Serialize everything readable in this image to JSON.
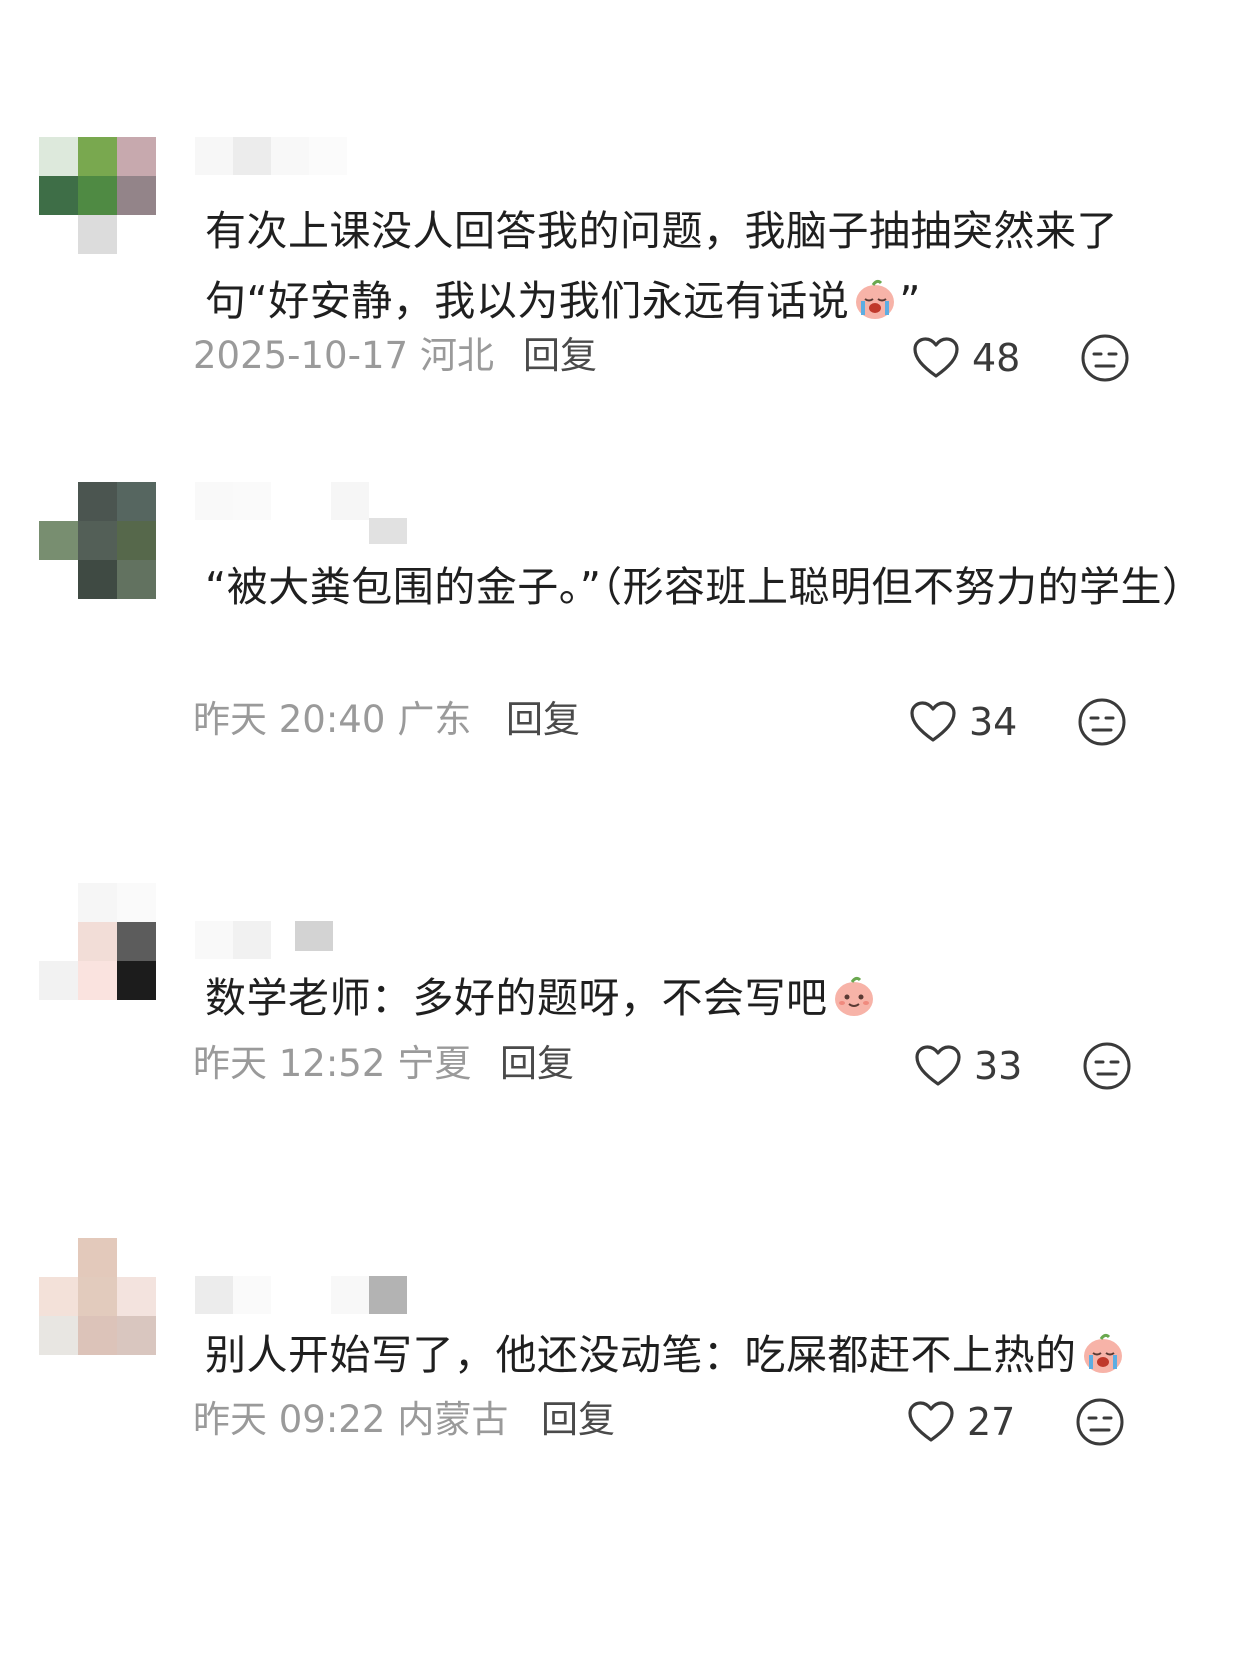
{
  "comments": [
    {
      "text": "有次上课没人回答我的问题，我脑子抽抽突然来了句“好安静，我以为我们永远有话说",
      "text_tail": "”",
      "emoji": "crying-peach-emoji",
      "time": "2025-10-17",
      "location": "河北",
      "reply_label": "回复",
      "likes": "48"
    },
    {
      "text": "“被大粪包围的金子。”（形容班上聪明但不努力的学生）",
      "text_tail": "",
      "emoji": "",
      "time": "昨天 20:40",
      "location": "广东",
      "reply_label": "回复",
      "likes": "34"
    },
    {
      "text": "数学老师：多好的题呀，不会写吧",
      "text_tail": "",
      "emoji": "smiling-peach-emoji",
      "time": "昨天 12:52",
      "location": "宁夏",
      "reply_label": "回复",
      "likes": "33"
    },
    {
      "text": "别人开始写了，他还没动笔：吃屎都赶不上热的",
      "text_tail": "",
      "emoji": "crying-peach-emoji",
      "time": "昨天 09:22",
      "location": "内蒙古",
      "reply_label": "回复",
      "likes": "27"
    }
  ],
  "icons": {
    "like": "heart-outline-icon",
    "dislike": "neutral-face-icon"
  },
  "colors": {
    "text": "#1f1f1f",
    "meta": "#9a9a9a",
    "reply": "#4a4a4a",
    "peach": "#f7b3a8"
  }
}
